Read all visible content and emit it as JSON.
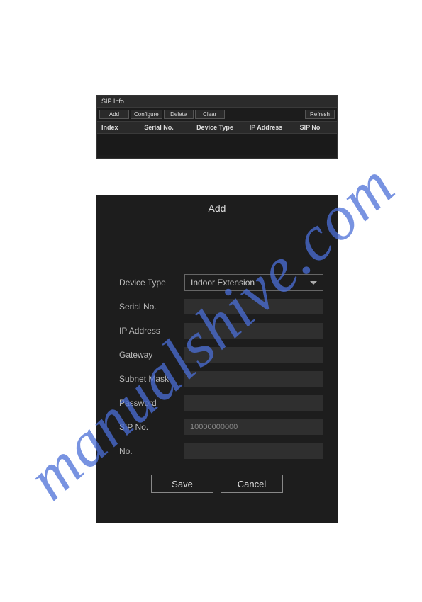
{
  "watermark": "manualshive.com",
  "sip_info": {
    "title": "SIP Info",
    "toolbar": {
      "add": "Add",
      "configure": "Configure",
      "delete": "Delete",
      "clear": "Clear",
      "refresh": "Refresh"
    },
    "columns": {
      "index": "Index",
      "serial": "Serial No.",
      "device": "Device Type",
      "ip": "IP Address",
      "sip": "SIP No"
    }
  },
  "add_dialog": {
    "title": "Add",
    "fields": {
      "device_type": {
        "label": "Device Type",
        "value": "Indoor Extension"
      },
      "serial_no": {
        "label": "Serial No.",
        "value": ""
      },
      "ip_address": {
        "label": "IP Address",
        "value": ""
      },
      "gateway": {
        "label": "Gateway",
        "value": ""
      },
      "subnet_mask": {
        "label": "Subnet Mask",
        "value": ""
      },
      "password": {
        "label": "Password",
        "value": ""
      },
      "sip_no": {
        "label": "SIP No.",
        "value": "10000000000"
      },
      "no": {
        "label": "No.",
        "value": ""
      }
    },
    "buttons": {
      "save": "Save",
      "cancel": "Cancel"
    }
  }
}
